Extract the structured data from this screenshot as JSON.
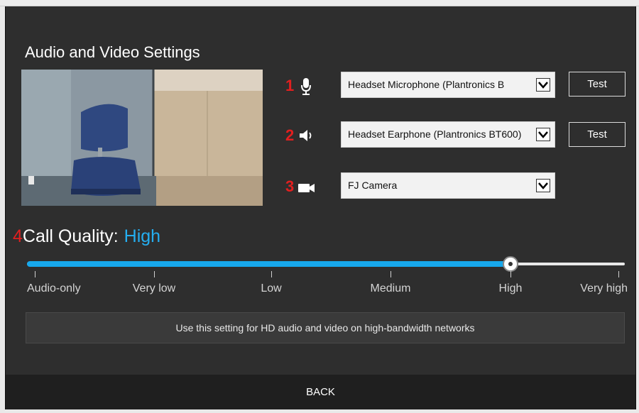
{
  "title": "Audio and Video Settings",
  "camera_preview": "webcam-preview",
  "devices": [
    {
      "number": "1",
      "icon": "microphone-icon",
      "selected": "Headset Microphone (Plantronics B",
      "test_label": "Test"
    },
    {
      "number": "2",
      "icon": "speaker-icon",
      "selected": "Headset Earphone (Plantronics BT600)",
      "test_label": "Test"
    },
    {
      "number": "3",
      "icon": "camera-icon",
      "selected": "FJ Camera"
    }
  ],
  "call_quality": {
    "number": "4",
    "label": "Call Quality:",
    "value": "High",
    "levels": [
      "Audio-only",
      "Very low",
      "Low",
      "Medium",
      "High",
      "Very high"
    ],
    "selected_index": 4,
    "description": "Use this setting for HD audio and video on high-bandwidth networks"
  },
  "back_label": "BACK",
  "colors": {
    "accent": "#17a8ec",
    "number_red": "#e21f1f",
    "panel": "#2e2e2e"
  }
}
